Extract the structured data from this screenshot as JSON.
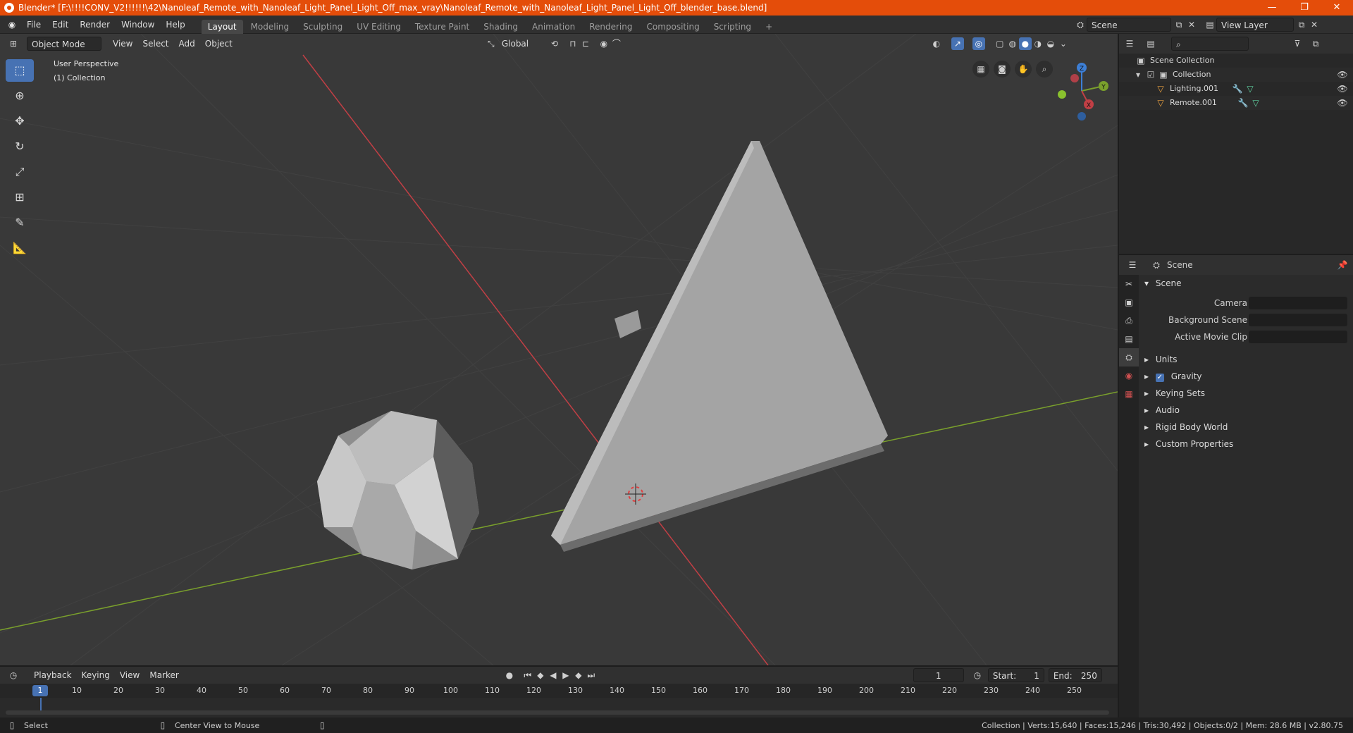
{
  "window": {
    "title": "Blender* [F:\\!!!!CONV_V2!!!!!!\\42\\Nanoleaf_Remote_with_Nanoleaf_Light_Panel_Light_Off_max_vray\\Nanoleaf_Remote_with_Nanoleaf_Light_Panel_Light_Off_blender_base.blend]",
    "minimize": "—",
    "maximize": "❐",
    "close": "✕"
  },
  "menu": [
    "File",
    "Edit",
    "Render",
    "Window",
    "Help"
  ],
  "workspaces": [
    "Layout",
    "Modeling",
    "Sculpting",
    "UV Editing",
    "Texture Paint",
    "Shading",
    "Animation",
    "Rendering",
    "Compositing",
    "Scripting"
  ],
  "workspace_add": "+",
  "scene_selector": {
    "label": "Scene"
  },
  "view_layer_selector": {
    "label": "View Layer"
  },
  "viewport": {
    "mode": "Object Mode",
    "menus": [
      "View",
      "Select",
      "Add",
      "Object"
    ],
    "orientation": "Global",
    "overlay_line1": "User Perspective",
    "overlay_line2": "(1) Collection",
    "gizmo": {
      "z": "Z",
      "y": "Y",
      "x": "X"
    }
  },
  "outliner": {
    "search_placeholder": "",
    "root": "Scene Collection",
    "collection": "Collection",
    "objects": [
      "Lighting.001",
      "Remote.001"
    ]
  },
  "properties": {
    "header": "Scene",
    "panel": "Scene",
    "fields": [
      {
        "label": "Camera",
        "value": ""
      },
      {
        "label": "Background Scene",
        "value": ""
      },
      {
        "label": "Active Movie Clip",
        "value": ""
      }
    ],
    "sections": [
      "Units",
      "Gravity",
      "Keying Sets",
      "Audio",
      "Rigid Body World",
      "Custom Properties"
    ],
    "gravity_checked": true
  },
  "timeline": {
    "menus": [
      "Playback",
      "Keying",
      "View",
      "Marker"
    ],
    "current_frame": "1",
    "start_label": "Start:",
    "start": "1",
    "end_label": "End:",
    "end": "250",
    "ruler": [
      "1",
      "10",
      "20",
      "30",
      "40",
      "50",
      "60",
      "70",
      "80",
      "90",
      "100",
      "110",
      "120",
      "130",
      "140",
      "150",
      "160",
      "170",
      "180",
      "190",
      "200",
      "210",
      "220",
      "230",
      "240",
      "250"
    ]
  },
  "status": {
    "left1": "Select",
    "left2": "Center View to Mouse",
    "stats": "Collection | Verts:15,640 | Faces:15,246 | Tris:30,492 | Objects:0/2 | Mem: 28.6 MB | v2.80.75"
  },
  "colors": {
    "titlebar": "#e44d0a",
    "accent": "#4772b3",
    "x_axis": "#c13f45",
    "y_axis": "#7aa02c",
    "z_axis": "#3d7fd6"
  }
}
